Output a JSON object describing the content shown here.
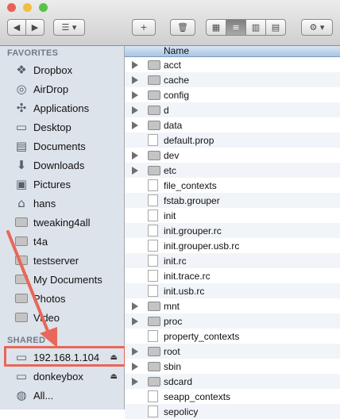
{
  "window": {
    "traffic_lights": [
      {
        "name": "close",
        "color": "#ec5f57"
      },
      {
        "name": "minimize",
        "color": "#f4bd3f"
      },
      {
        "name": "zoom",
        "color": "#58c346"
      }
    ]
  },
  "toolbar": {
    "back_icon": "◀",
    "forward_icon": "▶",
    "arrange_icon": "☰ ▾",
    "new_folder_icon": "+",
    "trash_icon": "🗑",
    "view_icons_icon": "▦",
    "view_list_icon": "≡",
    "view_columns_icon": "▥",
    "view_coverflow_icon": "▤",
    "action_icon": "⚙ ▾"
  },
  "sidebar": {
    "favorites_header": "FAVORITES",
    "favorites": [
      {
        "label": "Dropbox",
        "icon": "dropbox-icon"
      },
      {
        "label": "AirDrop",
        "icon": "airdrop-icon"
      },
      {
        "label": "Applications",
        "icon": "applications-icon"
      },
      {
        "label": "Desktop",
        "icon": "desktop-icon"
      },
      {
        "label": "Documents",
        "icon": "documents-icon"
      },
      {
        "label": "Downloads",
        "icon": "downloads-icon"
      },
      {
        "label": "Pictures",
        "icon": "pictures-icon"
      },
      {
        "label": "hans",
        "icon": "home-icon"
      },
      {
        "label": "tweaking4all",
        "icon": "folder-icon"
      },
      {
        "label": "t4a",
        "icon": "folder-icon"
      },
      {
        "label": "testserver",
        "icon": "folder-icon"
      },
      {
        "label": "My Documents",
        "icon": "folder-icon"
      },
      {
        "label": "Photos",
        "icon": "folder-icon"
      },
      {
        "label": "Video",
        "icon": "folder-icon"
      }
    ],
    "shared_header": "SHARED",
    "shared": [
      {
        "label": "192.168.1.104",
        "icon": "server-icon",
        "eject": "⏏"
      },
      {
        "label": "donkeybox",
        "icon": "server-icon",
        "eject": "⏏"
      },
      {
        "label": "All...",
        "icon": "network-icon",
        "eject": ""
      }
    ],
    "annotation_color": "#e8675a"
  },
  "main": {
    "column_header": "Name",
    "rows": [
      {
        "name": "acct",
        "type": "folder"
      },
      {
        "name": "cache",
        "type": "folder"
      },
      {
        "name": "config",
        "type": "folder"
      },
      {
        "name": "d",
        "type": "folder"
      },
      {
        "name": "data",
        "type": "folder"
      },
      {
        "name": "default.prop",
        "type": "file"
      },
      {
        "name": "dev",
        "type": "folder"
      },
      {
        "name": "etc",
        "type": "folder"
      },
      {
        "name": "file_contexts",
        "type": "file"
      },
      {
        "name": "fstab.grouper",
        "type": "file"
      },
      {
        "name": "init",
        "type": "file"
      },
      {
        "name": "init.grouper.rc",
        "type": "file"
      },
      {
        "name": "init.grouper.usb.rc",
        "type": "file"
      },
      {
        "name": "init.rc",
        "type": "file"
      },
      {
        "name": "init.trace.rc",
        "type": "file"
      },
      {
        "name": "init.usb.rc",
        "type": "file"
      },
      {
        "name": "mnt",
        "type": "folder"
      },
      {
        "name": "proc",
        "type": "folder"
      },
      {
        "name": "property_contexts",
        "type": "file"
      },
      {
        "name": "root",
        "type": "folder"
      },
      {
        "name": "sbin",
        "type": "folder"
      },
      {
        "name": "sdcard",
        "type": "folder"
      },
      {
        "name": "seapp_contexts",
        "type": "file"
      },
      {
        "name": "sepolicy",
        "type": "file"
      }
    ]
  }
}
